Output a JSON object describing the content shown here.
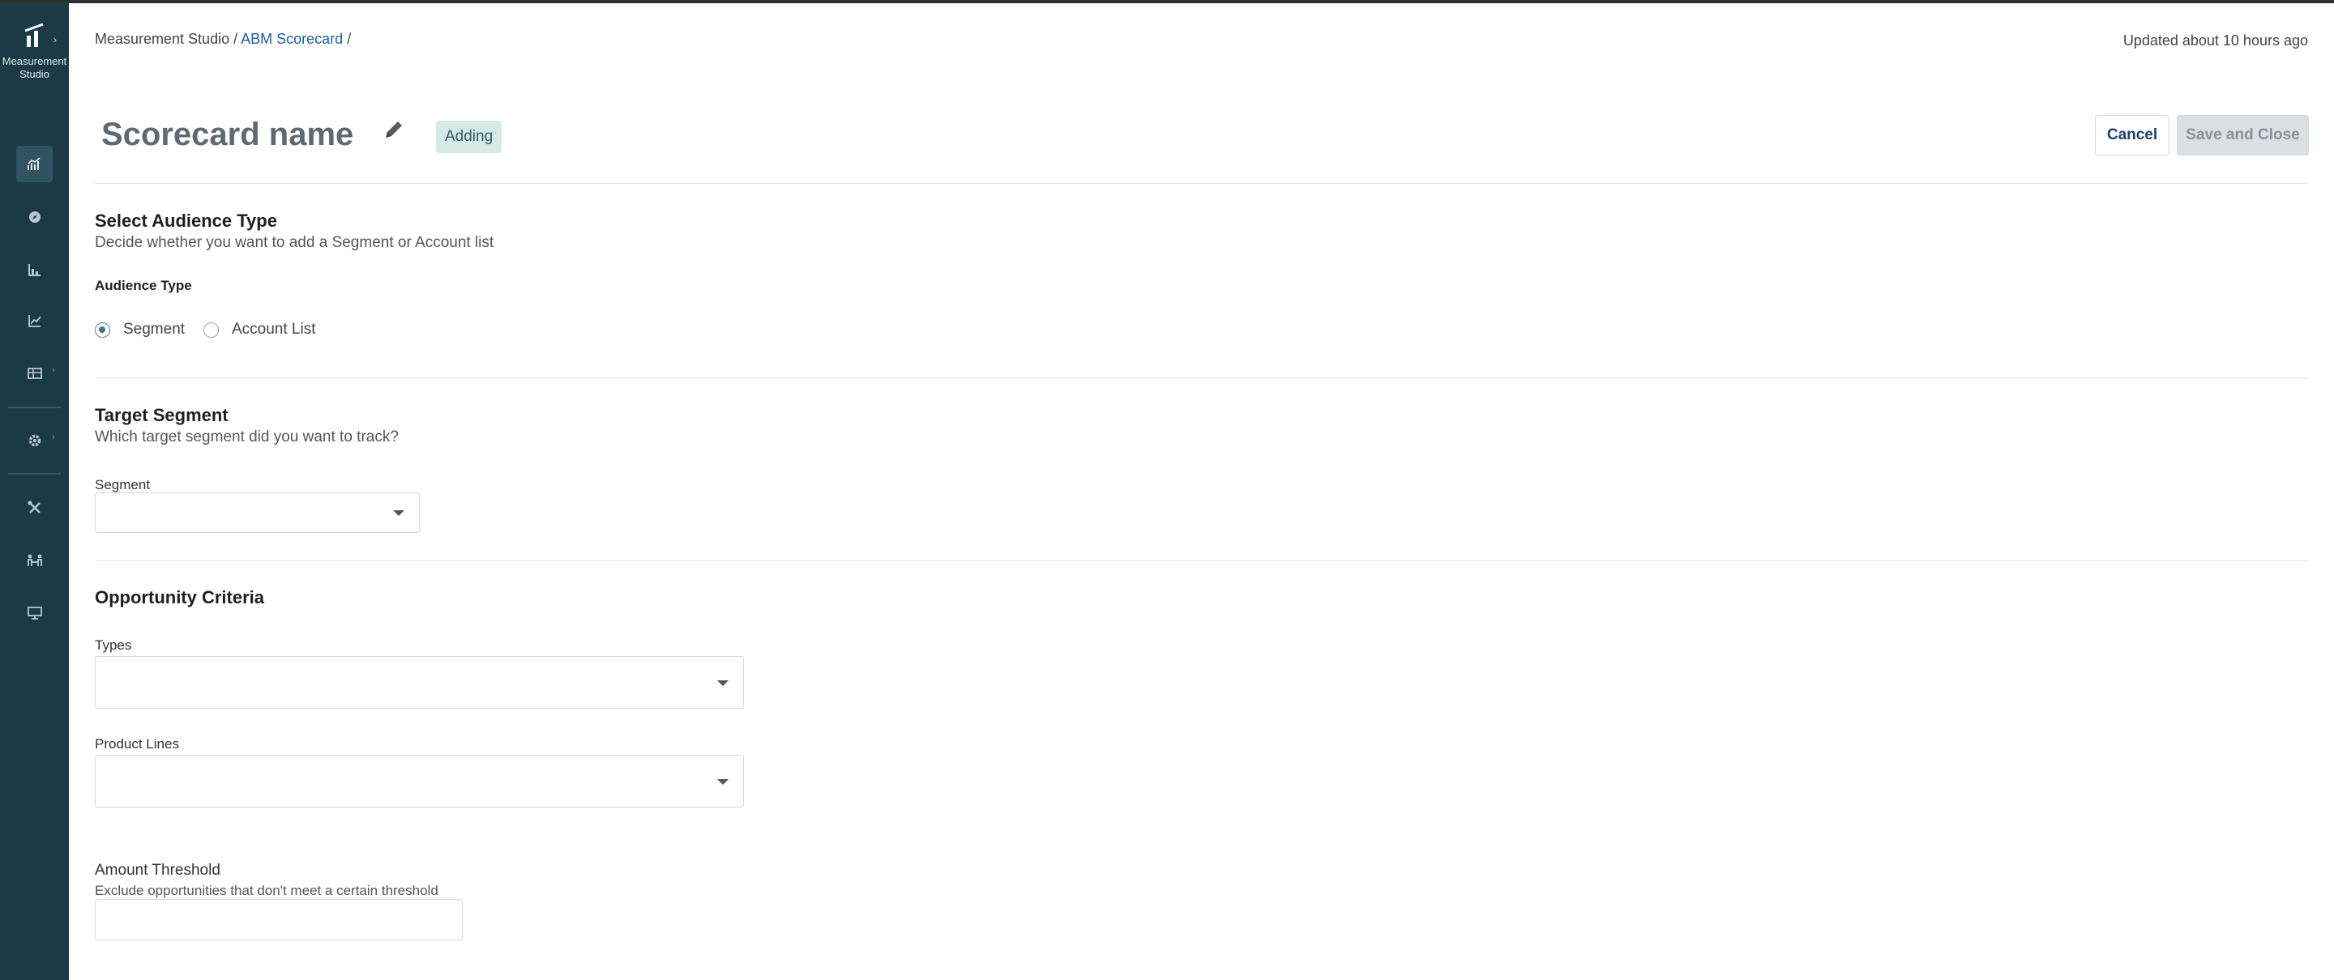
{
  "sidebar": {
    "brand_name": "Measurement Studio",
    "brand_line1": "Measurement",
    "brand_line2": "Studio",
    "background": "#1c3a46",
    "items": [
      {
        "icon": "analytics-chart-icon",
        "active": true
      },
      {
        "icon": "compass-icon"
      },
      {
        "icon": "bar-chart-icon"
      },
      {
        "icon": "line-chart-icon"
      },
      {
        "icon": "table-icon",
        "has_submenu": true
      },
      {
        "icon": "gear-icon",
        "has_submenu": true
      },
      {
        "icon": "tools-icon"
      },
      {
        "icon": "people-connect-icon"
      },
      {
        "icon": "presentation-icon"
      }
    ]
  },
  "breadcrumb": {
    "root": "Measurement Studio",
    "sep1": "/",
    "current": "ABM Scorecard",
    "sep2": "/"
  },
  "updated": "Updated about 10 hours ago",
  "header": {
    "title": "Scorecard name",
    "status_badge": "Adding",
    "cancel_label": "Cancel",
    "save_label": "Save and Close"
  },
  "audience": {
    "heading": "Select Audience Type",
    "description": "Decide whether you want to add a Segment or Account list",
    "field_label": "Audience Type",
    "options": [
      {
        "label": "Segment",
        "checked": true
      },
      {
        "label": "Account List",
        "checked": false
      }
    ]
  },
  "target": {
    "heading": "Target Segment",
    "description": "Which target segment did you want to track?",
    "segment_label": "Segment",
    "segment_value": ""
  },
  "opportunity": {
    "heading": "Opportunity Criteria",
    "types_label": "Types",
    "types_value": "",
    "product_lines_label": "Product Lines",
    "product_lines_value": "",
    "amount_label": "Amount Threshold",
    "amount_hint": "Exclude opportunities that don't meet a certain threshold",
    "amount_value": ""
  },
  "colors": {
    "accent_link": "#1b5fa8",
    "badge_bg": "#d5e9e6",
    "save_disabled_bg": "#dcdfe1"
  }
}
